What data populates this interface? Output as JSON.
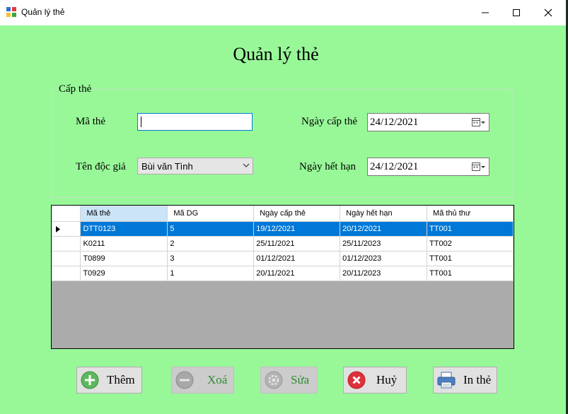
{
  "window": {
    "title": "Quản lý thẻ"
  },
  "heading": "Quản lý thẻ",
  "group": {
    "title": "Cấp thẻ",
    "ma_the_label": "Mã thẻ",
    "ma_the_value": "",
    "ten_doc_gia_label": "Tên độc giả",
    "ten_doc_gia_value": "Bùi văn Tình",
    "ngay_cap_label": "Ngày cấp thẻ",
    "ngay_cap_value": "24/12/2021",
    "ngay_het_label": "Ngày hết hạn",
    "ngay_het_value": "24/12/2021"
  },
  "grid": {
    "columns": [
      "Mã thẻ",
      "Mã DG",
      "Ngày cấp thẻ",
      "Ngày hết hạn",
      "Mã thủ thư"
    ],
    "rows": [
      [
        "DTT0123",
        "5",
        "19/12/2021",
        "20/12/2021",
        "TT001"
      ],
      [
        "K0211",
        "2",
        "25/11/2021",
        "25/11/2023",
        "TT002"
      ],
      [
        "T0899",
        "3",
        "01/12/2021",
        "01/12/2023",
        "TT001"
      ],
      [
        "T0929",
        "1",
        "20/11/2021",
        "20/11/2023",
        "TT001"
      ]
    ],
    "selected_row": 0
  },
  "buttons": {
    "them": "Thêm",
    "xoa": "Xoá",
    "sua": "Sửa",
    "huy": "Huỷ",
    "in_the": "In thẻ"
  },
  "colors": {
    "background": "#98f898",
    "selection": "#0078d7"
  }
}
